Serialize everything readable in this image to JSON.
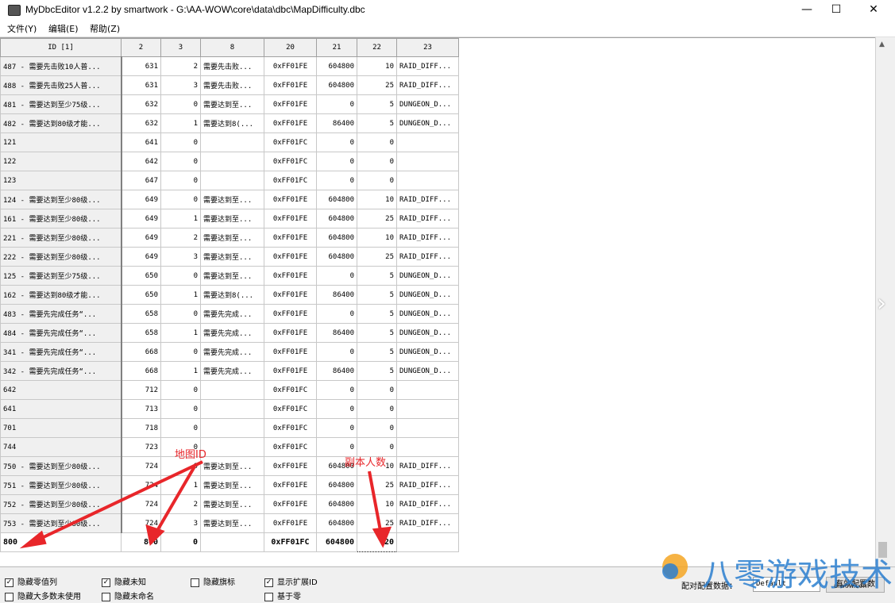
{
  "window": {
    "title": "MyDbcEditor v1.2.2 by smartwork - G:\\AA-WOW\\core\\data\\dbc\\MapDifficulty.dbc",
    "minimize": "—",
    "maximize": "☐",
    "close": "✕"
  },
  "menu": [
    "文件(Y)",
    "编辑(E)",
    "帮助(Z)"
  ],
  "columns": [
    "ID [1]",
    "2",
    "3",
    "8",
    "20",
    "21",
    "22",
    "23"
  ],
  "rows": [
    [
      "487 - 需要先击败10人普...",
      "631",
      "2",
      "需要先击败...",
      "0xFF01FE",
      "604800",
      "10",
      "RAID_DIFF..."
    ],
    [
      "488 - 需要先击败25人普...",
      "631",
      "3",
      "需要先击败...",
      "0xFF01FE",
      "604800",
      "25",
      "RAID_DIFF..."
    ],
    [
      "481 - 需要达到至少75级...",
      "632",
      "0",
      "需要达到至...",
      "0xFF01FE",
      "0",
      "5",
      "DUNGEON_D..."
    ],
    [
      "482 - 需要达到80级才能...",
      "632",
      "1",
      "需要达到8(...",
      "0xFF01FE",
      "86400",
      "5",
      "DUNGEON_D..."
    ],
    [
      "121",
      "641",
      "0",
      "",
      "0xFF01FC",
      "0",
      "0",
      ""
    ],
    [
      "122",
      "642",
      "0",
      "",
      "0xFF01FC",
      "0",
      "0",
      ""
    ],
    [
      "123",
      "647",
      "0",
      "",
      "0xFF01FC",
      "0",
      "0",
      ""
    ],
    [
      "124 - 需要达到至少80级...",
      "649",
      "0",
      "需要达到至...",
      "0xFF01FE",
      "604800",
      "10",
      "RAID_DIFF..."
    ],
    [
      "161 - 需要达到至少80级...",
      "649",
      "1",
      "需要达到至...",
      "0xFF01FE",
      "604800",
      "25",
      "RAID_DIFF..."
    ],
    [
      "221 - 需要达到至少80级...",
      "649",
      "2",
      "需要达到至...",
      "0xFF01FE",
      "604800",
      "10",
      "RAID_DIFF..."
    ],
    [
      "222 - 需要达到至少80级...",
      "649",
      "3",
      "需要达到至...",
      "0xFF01FE",
      "604800",
      "25",
      "RAID_DIFF..."
    ],
    [
      "125 - 需要达到至少75级...",
      "650",
      "0",
      "需要达到至...",
      "0xFF01FE",
      "0",
      "5",
      "DUNGEON_D..."
    ],
    [
      "162 - 需要达到80级才能...",
      "650",
      "1",
      "需要达到8(...",
      "0xFF01FE",
      "86400",
      "5",
      "DUNGEON_D..."
    ],
    [
      "483 - 需要先完成任务“...",
      "658",
      "0",
      "需要先完成...",
      "0xFF01FE",
      "0",
      "5",
      "DUNGEON_D..."
    ],
    [
      "484 - 需要先完成任务“...",
      "658",
      "1",
      "需要先完成...",
      "0xFF01FE",
      "86400",
      "5",
      "DUNGEON_D..."
    ],
    [
      "341 - 需要先完成任务“...",
      "668",
      "0",
      "需要先完成...",
      "0xFF01FE",
      "0",
      "5",
      "DUNGEON_D..."
    ],
    [
      "342 - 需要先完成任务“...",
      "668",
      "1",
      "需要先完成...",
      "0xFF01FE",
      "86400",
      "5",
      "DUNGEON_D..."
    ],
    [
      "642",
      "712",
      "0",
      "",
      "0xFF01FC",
      "0",
      "0",
      ""
    ],
    [
      "641",
      "713",
      "0",
      "",
      "0xFF01FC",
      "0",
      "0",
      ""
    ],
    [
      "701",
      "718",
      "0",
      "",
      "0xFF01FC",
      "0",
      "0",
      ""
    ],
    [
      "744",
      "723",
      "0",
      "",
      "0xFF01FC",
      "0",
      "0",
      ""
    ],
    [
      "750 - 需要达到至少80级...",
      "724",
      "0",
      "需要达到至...",
      "0xFF01FE",
      "604800",
      "10",
      "RAID_DIFF..."
    ],
    [
      "751 - 需要达到至少80级...",
      "724",
      "1",
      "需要达到至...",
      "0xFF01FE",
      "604800",
      "25",
      "RAID_DIFF..."
    ],
    [
      "752 - 需要达到至少80级...",
      "724",
      "2",
      "需要达到至...",
      "0xFF01FE",
      "604800",
      "10",
      "RAID_DIFF..."
    ],
    [
      "753 - 需要达到至少80级...",
      "724",
      "3",
      "需要达到至...",
      "0xFF01FE",
      "604800",
      "25",
      "RAID_DIFF..."
    ]
  ],
  "edit_row": [
    "800",
    "800",
    "0",
    "",
    "0xFF01FC",
    "604800",
    "20",
    ""
  ],
  "annotations": {
    "map_id": "地图ID",
    "player_count": "副本人数",
    "arrow_color": "#e8262a"
  },
  "options": {
    "hide_zero_cols": {
      "label": "隐藏零值列",
      "checked": true
    },
    "hide_unknown": {
      "label": "隐藏未知",
      "checked": true
    },
    "hide_flags": {
      "label": "隐藏旗标",
      "checked": false
    },
    "show_ext_id": {
      "label": "显示扩展ID",
      "checked": true
    },
    "hide_most_unused": {
      "label": "隐藏大多数未使用",
      "checked": false
    },
    "hide_unnamed": {
      "label": "隐藏未命名",
      "checked": false
    },
    "base_zero": {
      "label": "基于零",
      "checked": false
    }
  },
  "config": {
    "label": "配对配置数据：",
    "select_value": "Default",
    "button_label": "有效配置数"
  },
  "watermark": {
    "text": "八零游戏技术",
    "url": "uiwow.com"
  }
}
